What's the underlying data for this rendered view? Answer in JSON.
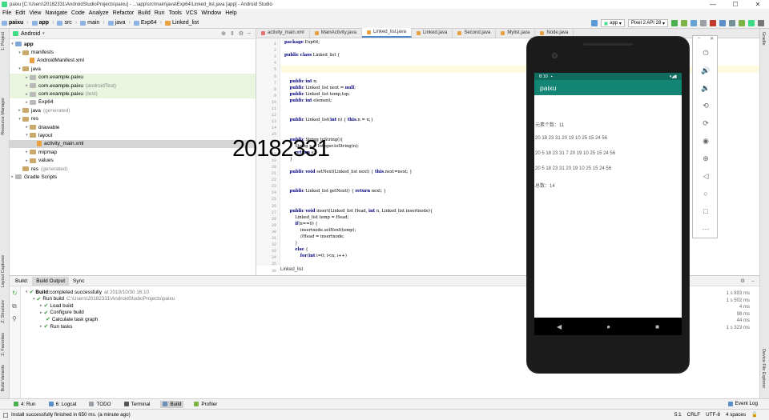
{
  "window": {
    "title": "paixu [C:\\Users\\20182331\\AndroidStudioProjects\\paixu] - ...\\app\\src\\main\\java\\Exp64\\Linked_list.java [app] - Android Studio",
    "buttons": [
      "—",
      "☐",
      "✕"
    ]
  },
  "menu": [
    "File",
    "Edit",
    "View",
    "Navigate",
    "Code",
    "Analyze",
    "Refactor",
    "Build",
    "Run",
    "Tools",
    "VCS",
    "Window",
    "Help"
  ],
  "breadcrumb": [
    "paixu",
    "app",
    "src",
    "main",
    "java",
    "Exp64",
    "Linked_list"
  ],
  "toolbar": {
    "run_config": "app",
    "device": "Pixel 2 API 28"
  },
  "left_strip": [
    "1: Project",
    "Resource Manager",
    "Layout Captures",
    "Z: Structure",
    "2: Favorites",
    "Build Variants"
  ],
  "right_strip": [
    "Gradle",
    "Device File Explorer"
  ],
  "project": {
    "view": "Android",
    "tree": [
      {
        "label": "app",
        "indent": 0,
        "arrow": "▾",
        "icon": "folder-blue",
        "bold": true
      },
      {
        "label": "manifests",
        "indent": 1,
        "arrow": "▾",
        "icon": "folder",
        "bold": false
      },
      {
        "label": "AndroidManifest.xml",
        "indent": 2,
        "arrow": "",
        "icon": "file",
        "bold": false
      },
      {
        "label": "java",
        "indent": 1,
        "arrow": "▾",
        "icon": "folder",
        "bold": false
      },
      {
        "label": "com.example.paixu",
        "indent": 2,
        "arrow": "▸",
        "icon": "folder-grey",
        "bold": false,
        "hl": "green"
      },
      {
        "label": "com.example.paixu",
        "hint": "(androidTest)",
        "indent": 2,
        "arrow": "▸",
        "icon": "folder-grey",
        "bold": false,
        "hl": "green"
      },
      {
        "label": "com.example.paixu",
        "hint": "(test)",
        "indent": 2,
        "arrow": "▸",
        "icon": "folder-grey",
        "bold": false,
        "hl": "green"
      },
      {
        "label": "Exp64",
        "indent": 2,
        "arrow": "▸",
        "icon": "folder-grey",
        "bold": false
      },
      {
        "label": "java",
        "hint": "(generated)",
        "indent": 1,
        "arrow": "▸",
        "icon": "folder",
        "bold": false
      },
      {
        "label": "res",
        "indent": 1,
        "arrow": "▾",
        "icon": "folder",
        "bold": false
      },
      {
        "label": "drawable",
        "indent": 2,
        "arrow": "▸",
        "icon": "folder",
        "bold": false
      },
      {
        "label": "layout",
        "indent": 2,
        "arrow": "▾",
        "icon": "folder",
        "bold": false
      },
      {
        "label": "activity_main.xml",
        "indent": 3,
        "arrow": "",
        "icon": "file",
        "bold": false,
        "hl": "sel"
      },
      {
        "label": "mipmap",
        "indent": 2,
        "arrow": "▸",
        "icon": "folder",
        "bold": false
      },
      {
        "label": "values",
        "indent": 2,
        "arrow": "▸",
        "icon": "folder",
        "bold": false
      },
      {
        "label": "res",
        "hint": "(generated)",
        "indent": 1,
        "arrow": "",
        "icon": "folder",
        "bold": false
      },
      {
        "label": "Gradle Scripts",
        "indent": 0,
        "arrow": "▸",
        "icon": "folder-grey",
        "bold": false
      }
    ]
  },
  "editor": {
    "tabs": [
      "activity_main.xml",
      "MainActivity.java",
      "Linked_list.java",
      "Linked.java",
      "Second.java",
      "Mylist.java",
      "Node.java"
    ],
    "active_tab": 2,
    "line_numbers": [
      "1",
      "2",
      "3",
      "4",
      "5",
      "6",
      "7",
      "8",
      "9",
      "10",
      "11",
      "12",
      "13",
      "14",
      "15",
      "16",
      "17",
      "18",
      "19",
      "20",
      "21",
      "22",
      "23",
      "24",
      "25",
      "26",
      "27",
      "28",
      "29",
      "30",
      "31",
      "32",
      "33",
      "34",
      "35",
      "36"
    ],
    "code": [
      "package Exp64;",
      "",
      "public class Linked_list {",
      "",
      "",
      "",
      "    public int n;",
      "    public Linked_list next = null;",
      "    public Linked_list temp,top;",
      "    public int element;",
      "",
      "",
      "    public Linked_list(int n) { this.n = n;}",
      "",
      "",
      "    public String toString(){",
      "        String s = Integer.toString(n);",
      "        return s;",
      "    }",
      "",
      "    public void setNext(Linked_list next) { this.next=next; }",
      "",
      "",
      "    public Linked_list getNext() { return next; }",
      "",
      "",
      "    public void insert(Linked_list Head, int n, Linked_list insertnode){",
      "        Linked_list temp = Head;",
      "        if(n==0) {",
      "            insertnode.setNext(temp);",
      "            //Head = insertnode;",
      "        }",
      "        else {",
      "            for(int i=0; i<n; i++)"
    ],
    "breadcrumb": "Linked_list"
  },
  "watermark": "20182331",
  "build": {
    "label": "Build:",
    "tabs": [
      "Build Output",
      "Sync"
    ],
    "lines": [
      {
        "indent": 0,
        "arrow": "▾",
        "text": "Build:",
        "rest": " completed successfully",
        "gray": "at 2019/10/30 16:10",
        "duration": "1 s 893 ms"
      },
      {
        "indent": 1,
        "arrow": "▾",
        "text": "Run build",
        "gray": "C:\\Users\\20182331\\AndroidStudioProjects\\paixu",
        "duration": "1 s 502 ms"
      },
      {
        "indent": 2,
        "arrow": "▸",
        "text": "Load build",
        "gray": "",
        "duration": "4 ms"
      },
      {
        "indent": 2,
        "arrow": "▸",
        "text": "Configure build",
        "gray": "",
        "duration": "98 ms"
      },
      {
        "indent": 2,
        "arrow": "",
        "text": "Calculate task graph",
        "gray": "",
        "duration": "44 ms"
      },
      {
        "indent": 2,
        "arrow": "▸",
        "text": "Run tasks",
        "gray": "",
        "duration": "1 s 323 ms"
      }
    ]
  },
  "bottom_tools": [
    "4: Run",
    "6: Logcat",
    "TODO",
    "Terminal",
    "Build",
    "Profiler"
  ],
  "bottom_active": 4,
  "event_log": "Event Log",
  "status": {
    "message": "Install successfully finished in 650 ms. (a minute ago)",
    "position": "5:1",
    "line_sep": "CRLF",
    "encoding": "UTF-8",
    "indent": "4 spaces"
  },
  "phone": {
    "time": "8:10",
    "app_title": "paixu",
    "lines": [
      "元素个数：11",
      "20 18 23 31 20 19 10 25 15 24 56",
      "20 5 18 23 31 7 20 19 10 25 15 24 56",
      "20 5 18 23 31 20 19 10 25 15 24 56",
      "总数：14"
    ]
  },
  "colors": {
    "app_bar": "#128574",
    "status_bar": "#0e6b5d",
    "keyword": "#000080"
  }
}
